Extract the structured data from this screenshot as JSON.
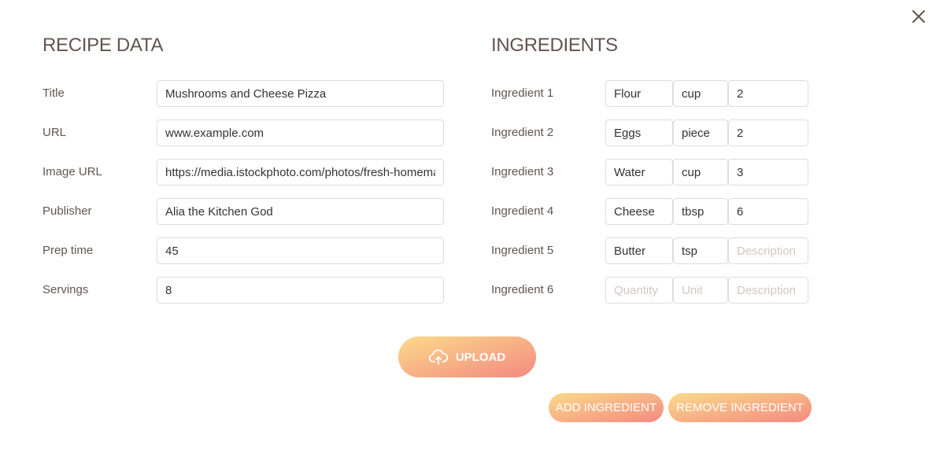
{
  "recipe": {
    "heading": "RECIPE DATA",
    "fields": [
      {
        "label": "Title",
        "value": "Mushrooms and Cheese Pizza"
      },
      {
        "label": "URL",
        "value": "www.example.com"
      },
      {
        "label": "Image URL",
        "value": "https://media.istockphoto.com/photos/fresh-homemade-pizza"
      },
      {
        "label": "Publisher",
        "value": "Alia the Kitchen God"
      },
      {
        "label": "Prep time",
        "value": "45"
      },
      {
        "label": "Servings",
        "value": "8"
      }
    ]
  },
  "ingredients": {
    "heading": "INGREDIENTS",
    "rows": [
      {
        "label": "Ingredient 1",
        "quantity": "Flour",
        "unit": "cup",
        "description": "2"
      },
      {
        "label": "Ingredient 2",
        "quantity": "Eggs",
        "unit": "piece",
        "description": "2"
      },
      {
        "label": "Ingredient 3",
        "quantity": "Water",
        "unit": "cup",
        "description": "3"
      },
      {
        "label": "Ingredient 4",
        "quantity": "Cheese",
        "unit": "tbsp",
        "description": "6"
      },
      {
        "label": "Ingredient 5",
        "quantity": "Butter",
        "unit": "tsp",
        "description": ""
      },
      {
        "label": "Ingredient 6",
        "quantity": "",
        "unit": "",
        "description": ""
      }
    ],
    "placeholders": {
      "quantity": "Quantity",
      "unit": "Unit",
      "description": "Description"
    }
  },
  "buttons": {
    "upload": "UPLOAD",
    "add_ingredient": "ADD INGREDIENT",
    "remove_ingredient": "REMOVE INGREDIENT"
  },
  "icons": {
    "close": "close-icon",
    "upload": "cloud-upload-icon"
  },
  "colors": {
    "text": "#615551",
    "gradient_start": "#fbdb89",
    "gradient_end": "#f48982",
    "border": "#dddddd",
    "placeholder": "#d3c7c3"
  }
}
